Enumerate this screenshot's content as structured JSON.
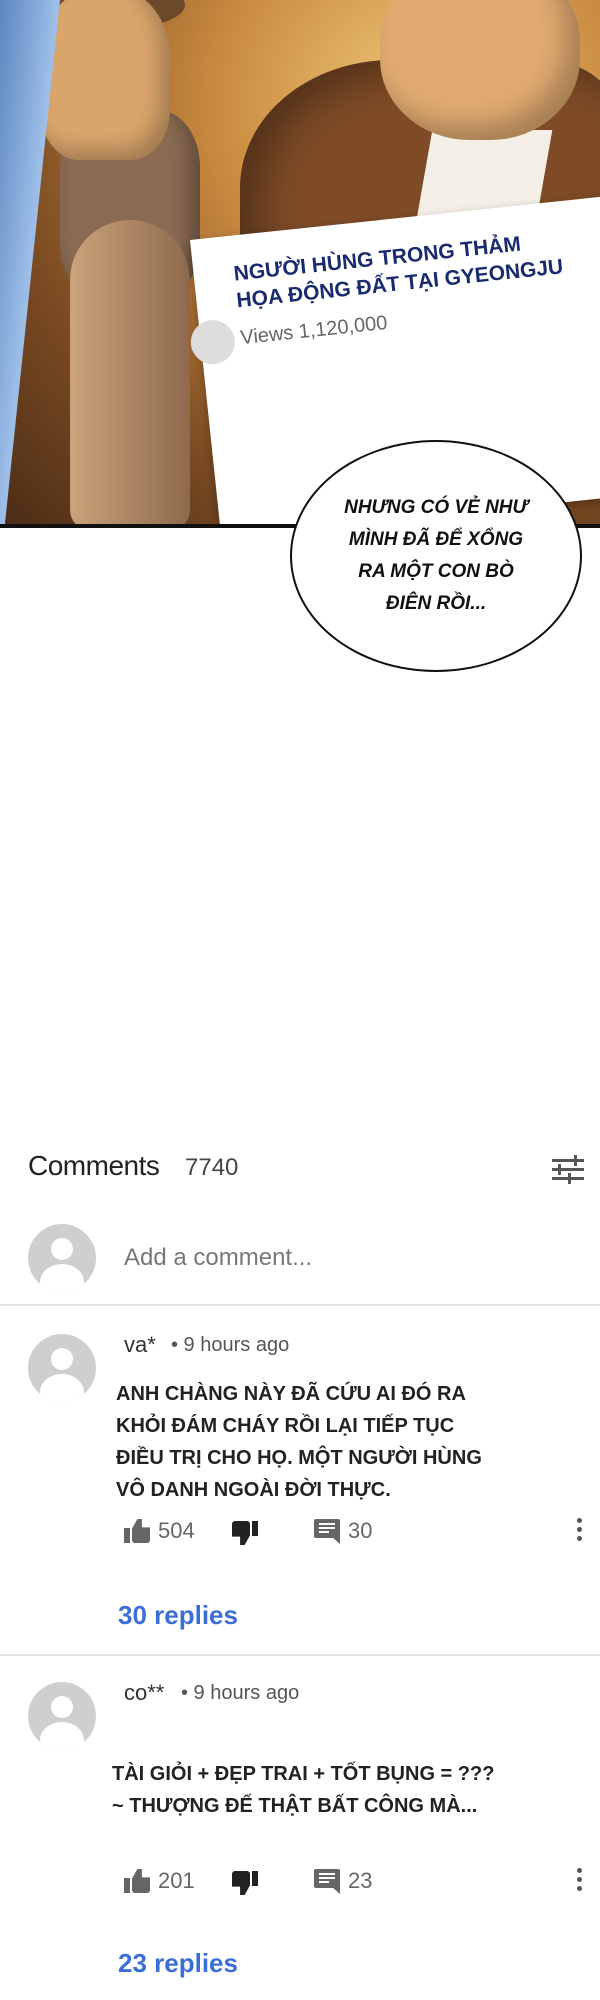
{
  "panel": {
    "card_title": "Người hùng trong thảm họa động đất tại Gyeongju",
    "card_views": "Views 1,120,000",
    "speech_bubble": "Nhưng có vẻ như mình đã để xổng ra một con bò điên rồi..."
  },
  "comments": {
    "title": "Comments",
    "count": "7740",
    "add_placeholder": "Add a comment...",
    "items": [
      {
        "author": "va*",
        "time": "• 9 hours ago",
        "text": "Anh chàng này đã cứu ai đó ra khỏi đám cháy rồi lại tiếp tục điều trị cho họ. Một người hùng vô danh ngoài đời thực.",
        "likes": "504",
        "reply_count": "30",
        "replies_link": "30 replies"
      },
      {
        "author": "co**",
        "time": "• 9 hours ago",
        "text": "Tài giỏi + đẹp trai + tốt bụng = ??? ~ Thượng đế thật bất công mà...",
        "likes": "201",
        "reply_count": "23",
        "replies_link": "23 replies"
      }
    ]
  },
  "icons": {
    "filter": "sliders-icon",
    "like": "thumbs-up-icon",
    "dislike": "thumbs-down-icon",
    "reply": "comment-icon",
    "more": "more-vertical-icon",
    "avatar": "user-avatar-icon"
  },
  "colors": {
    "link": "#3b6fd6",
    "card_title": "#1a2a6e"
  }
}
